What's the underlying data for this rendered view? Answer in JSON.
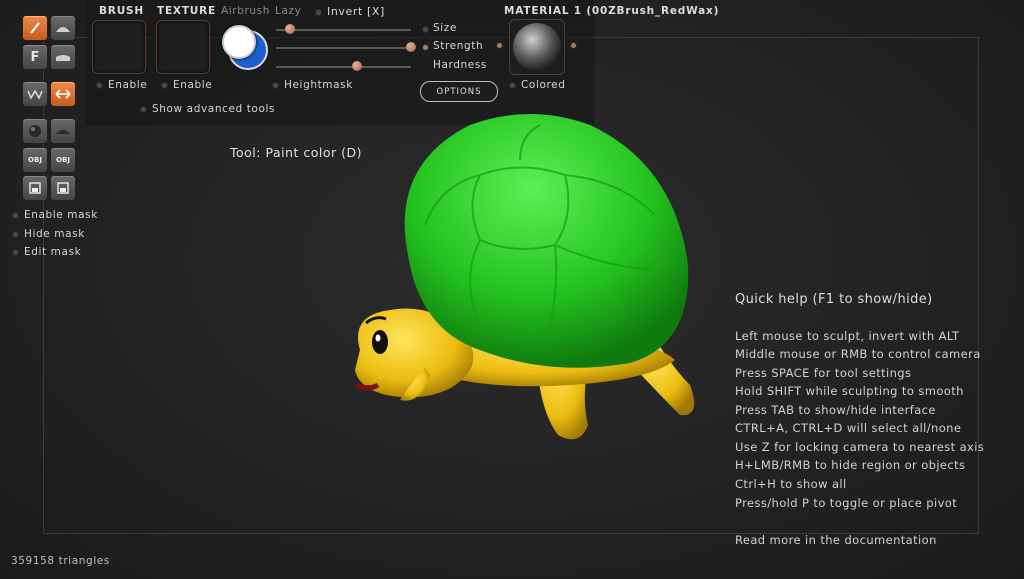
{
  "toolbar": {
    "brush_label": "BRUSH",
    "texture_label": "TEXTURE",
    "airbrush_label": "Airbrush",
    "lazy_label": "Lazy",
    "invert_label": "Invert [X]",
    "brush_enable_label": "Enable",
    "texture_enable_label": "Enable",
    "heightmask_label": "Heightmask",
    "show_advanced_label": "Show advanced tools",
    "size_label": "Size",
    "strength_label": "Strength",
    "hardness_label": "Hardness",
    "options_label": "OPTIONS",
    "material_label": "MATERIAL 1 (00ZBrush_RedWax)",
    "colored_label": "Colored",
    "size_value": 0.1,
    "strength_value": 1.0,
    "hardness_value": 0.6,
    "paint_color": "#1e5fcf",
    "secondary_color": "#ffffff"
  },
  "sidebar": {
    "enable_mask_label": "Enable mask",
    "hide_mask_label": "Hide mask",
    "edit_mask_label": "Edit mask",
    "obj_label_1": "OBJ",
    "obj_label_2": "OBJ",
    "f_label": "F"
  },
  "viewport": {
    "tool_label": "Tool: Paint color (D)",
    "triangle_count": "359158 triangles"
  },
  "help": {
    "title": "Quick help (F1 to show/hide)",
    "lines": [
      "Left mouse to sculpt, invert with ALT",
      "Middle mouse or RMB to control camera",
      "Press SPACE for tool settings",
      "Hold SHIFT while sculpting to smooth",
      "Press TAB to show/hide interface",
      "CTRL+A, CTRL+D will select all/none",
      "Use Z for locking camera to nearest axis",
      "H+LMB/RMB to hide region or objects",
      "Ctrl+H to show all",
      "Press/hold P to toggle or place pivot"
    ],
    "footer": "Read more in the documentation"
  },
  "colors": {
    "accent": "#e0743a",
    "shell": "#2fcf2a",
    "body": "#f0c418"
  }
}
